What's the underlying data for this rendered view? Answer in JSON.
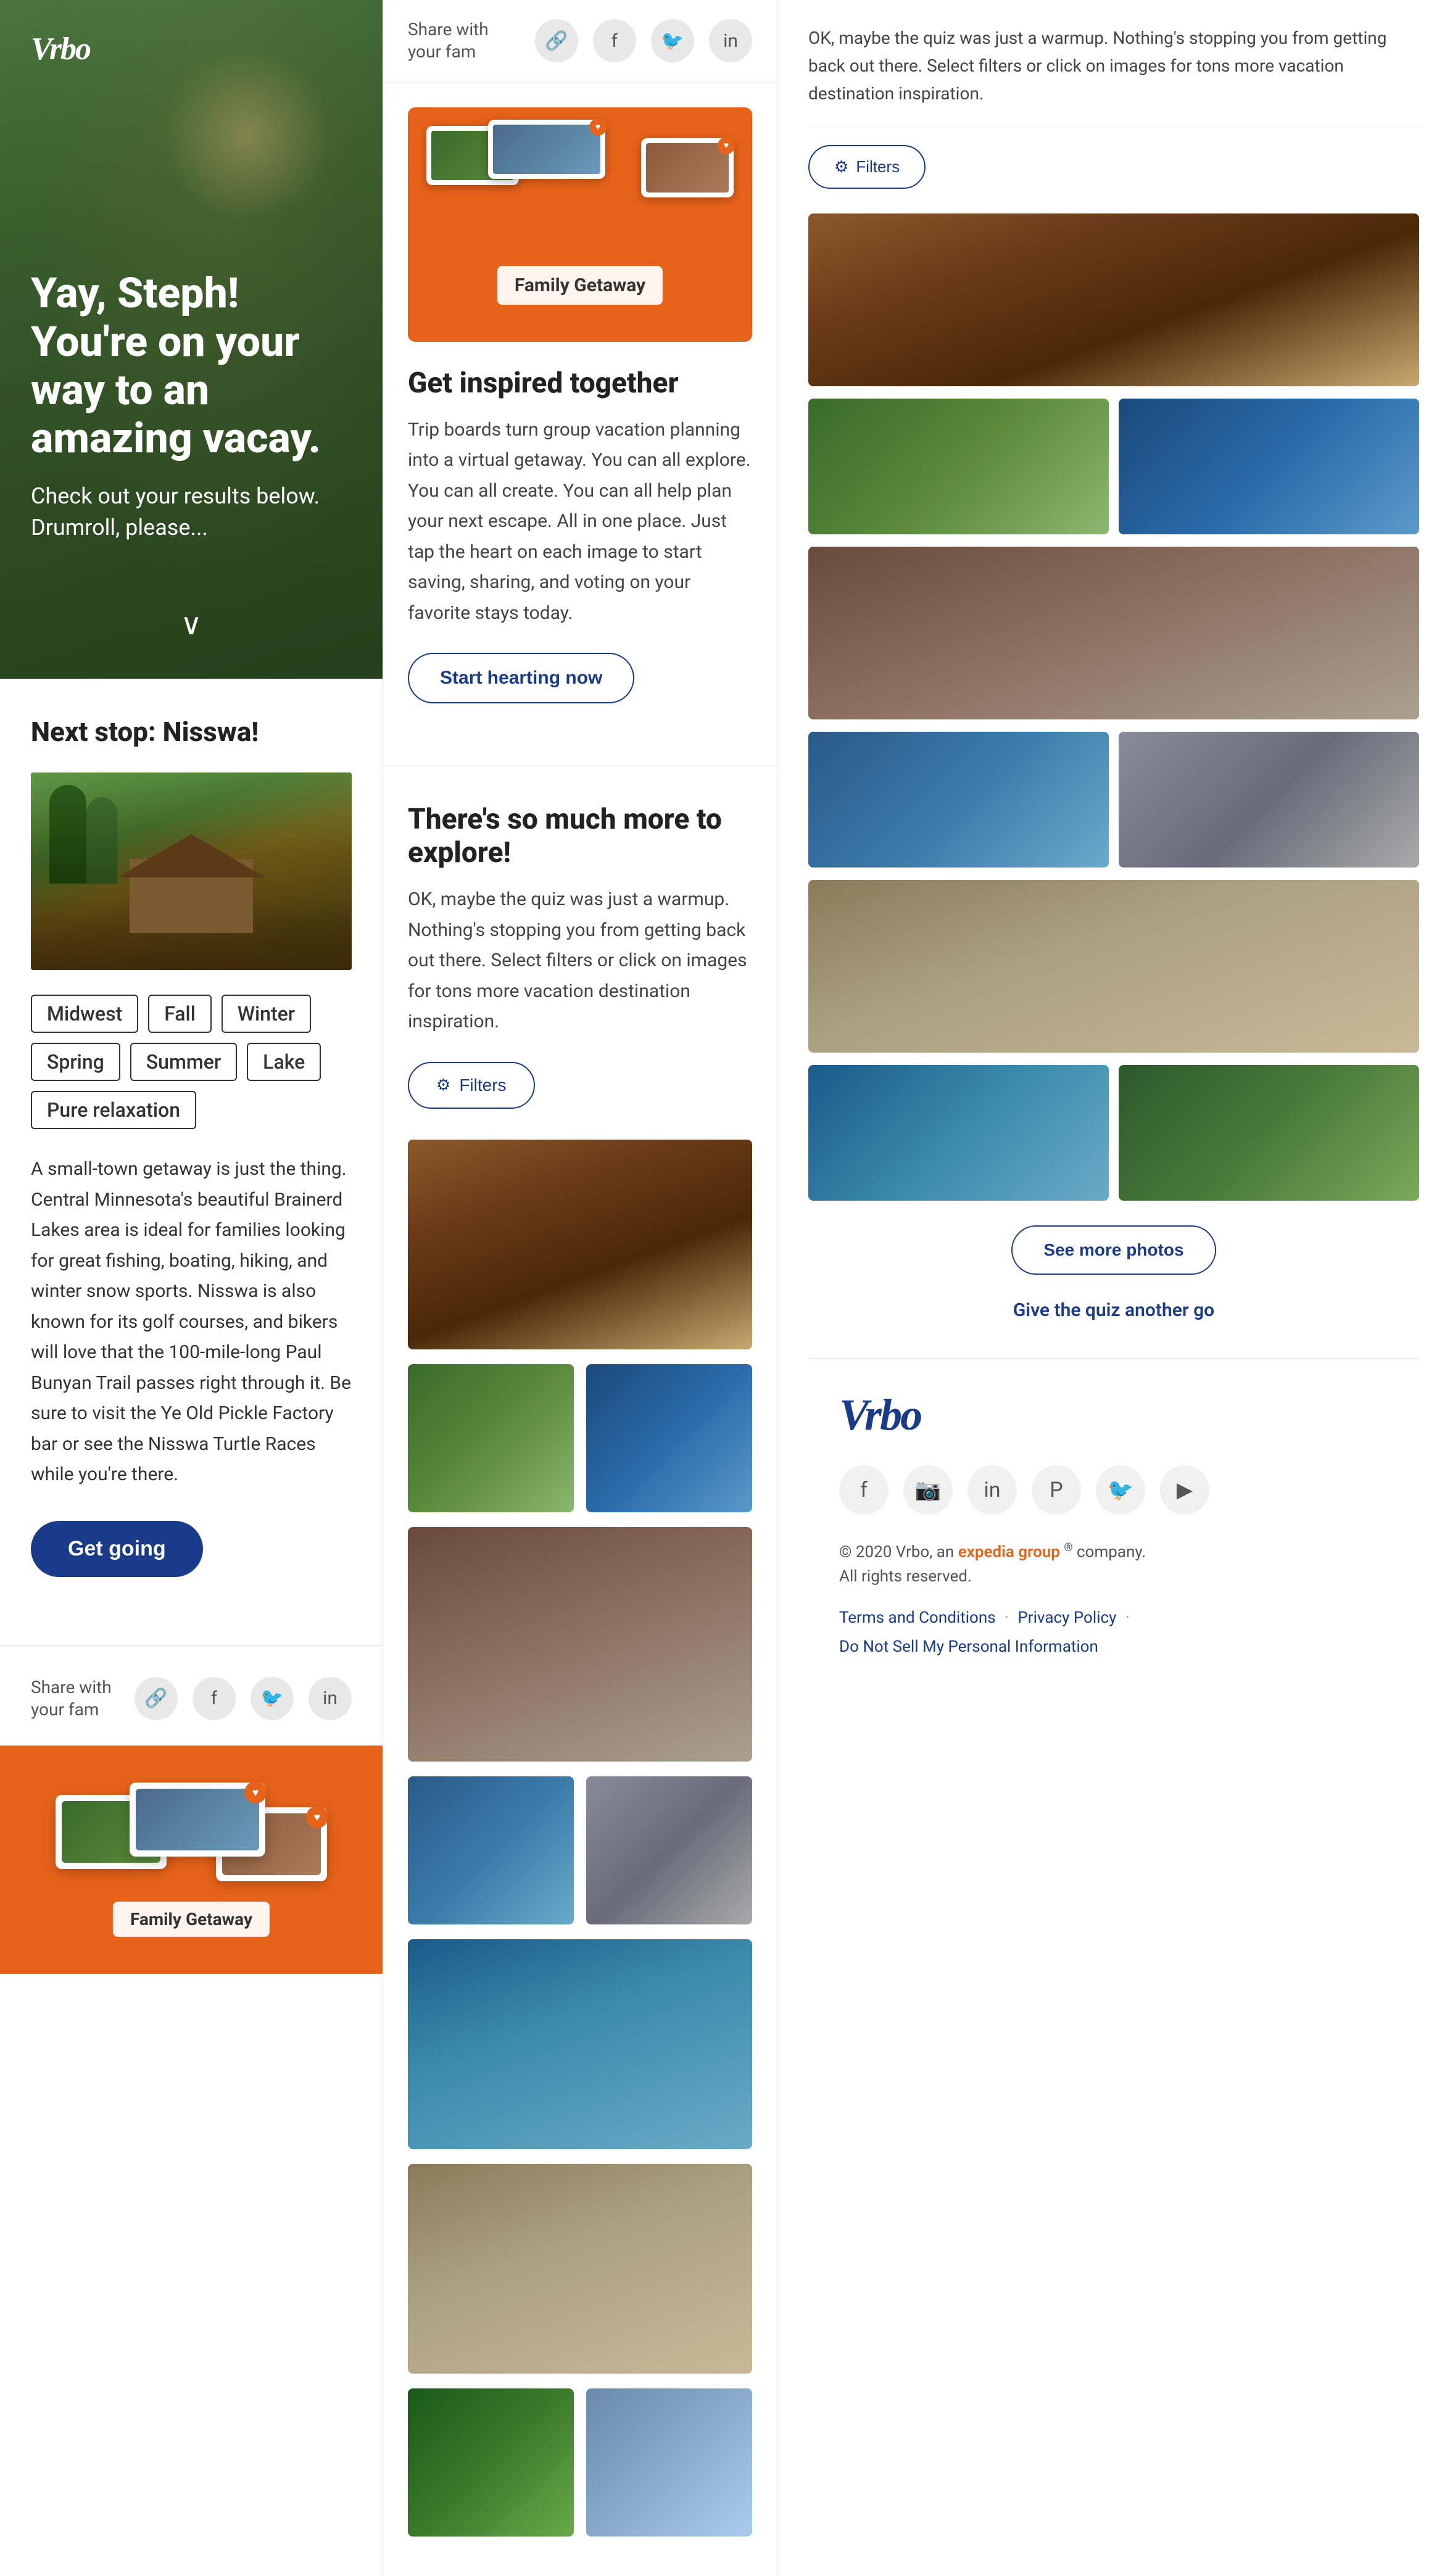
{
  "vrbo": {
    "logo": "Vrbo",
    "footer_logo": "Vrbo"
  },
  "hero": {
    "greeting": "Yay, Steph! You're on your way to an amazing vacay.",
    "subtext": "Check out your results below. Drumroll, please..."
  },
  "destination": {
    "next_stop": "Next stop: Nisswa!",
    "tags": [
      "Midwest",
      "Fall",
      "Winter",
      "Spring",
      "Summer",
      "Lake",
      "Pure relaxation"
    ],
    "description": "A small-town getaway is just the thing. Central Minnesota's beautiful Brainerd Lakes area is ideal for families looking for great fishing, boating, hiking, and winter snow sports. Nisswa is also known for its golf courses, and bikers will love that the 100-mile-long Paul Bunyan Trail passes right through it. Be sure to visit the Ye Old Pickle Factory bar or see the Nisswa Turtle Races while you're there.",
    "get_going_label": "Get going"
  },
  "share": {
    "text": "Share with your fam"
  },
  "trip_board": {
    "section_title": "Get inspired together",
    "section_desc": "Trip boards turn group vacation planning into a virtual getaway. You can all explore. You can all create. You can all help plan your next escape. All in one place. Just tap the heart on each image to start saving, sharing, and voting on your favorite stays today.",
    "start_hearting_label": "Start hearting now",
    "family_getaway_label": "Family Getaway"
  },
  "explore": {
    "section_title": "There's so much more to explore!",
    "section_desc": "OK, maybe the quiz was just a warmup. Nothing's stopping you from getting back out there. Select filters or click on images for tons more vacation destination inspiration.",
    "filters_label": "Filters",
    "see_more_photos_label": "See more photos",
    "give_quiz_label": "Give the quiz another go"
  },
  "footer": {
    "copyright": "© 2020 Vrbo, an",
    "expedia": "expedia group",
    "copyright2": "company.",
    "rights": "All rights reserved.",
    "terms_label": "Terms and Conditions",
    "privacy_label": "Privacy Policy",
    "do_not_sell_label": "Do Not Sell My Personal Information",
    "social_icons": [
      "fb",
      "ig",
      "li",
      "pi",
      "tw",
      "yt"
    ]
  }
}
